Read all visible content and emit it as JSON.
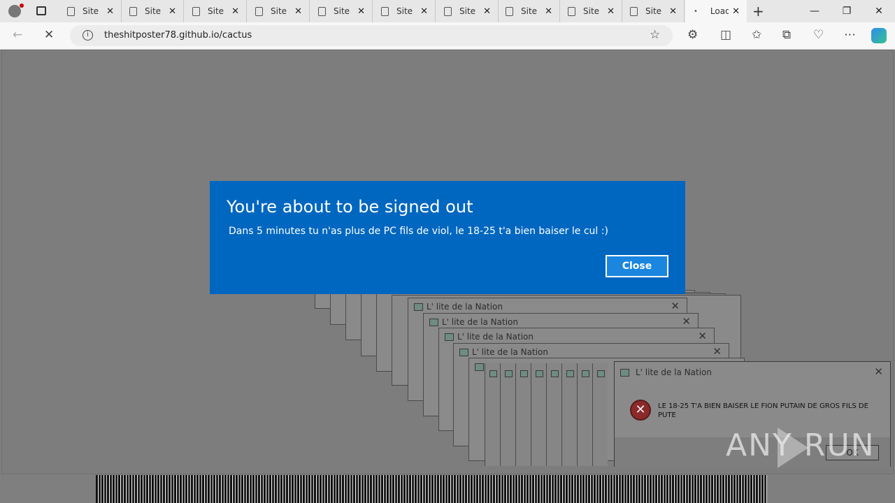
{
  "browser": {
    "tabs": [
      {
        "label": "Site"
      },
      {
        "label": "Site"
      },
      {
        "label": "Site"
      },
      {
        "label": "Site"
      },
      {
        "label": "Site"
      },
      {
        "label": "Site"
      },
      {
        "label": "Site"
      },
      {
        "label": "Site"
      },
      {
        "label": "Site"
      },
      {
        "label": "Site"
      }
    ],
    "active_tab": {
      "label": "Load"
    },
    "url": "theshitposter78.github.io/cactus"
  },
  "toast": {
    "title": "You're about to be signed out",
    "body": "Dans 5 minutes tu n'as plus de PC fils de viol, le 18-25 t'a bien baiser le cul :)",
    "close_label": "Close"
  },
  "popup": {
    "title": "L' lite de la Nation",
    "message": "LE 18-25 T'A BIEN BAISER LE FION PUTAIN DE GROS FILS DE PUTE",
    "button_label": "OK"
  },
  "watermark": "ANY RUN",
  "colors": {
    "toast_bg": "#0067c0",
    "error_red": "#c42b1c"
  }
}
